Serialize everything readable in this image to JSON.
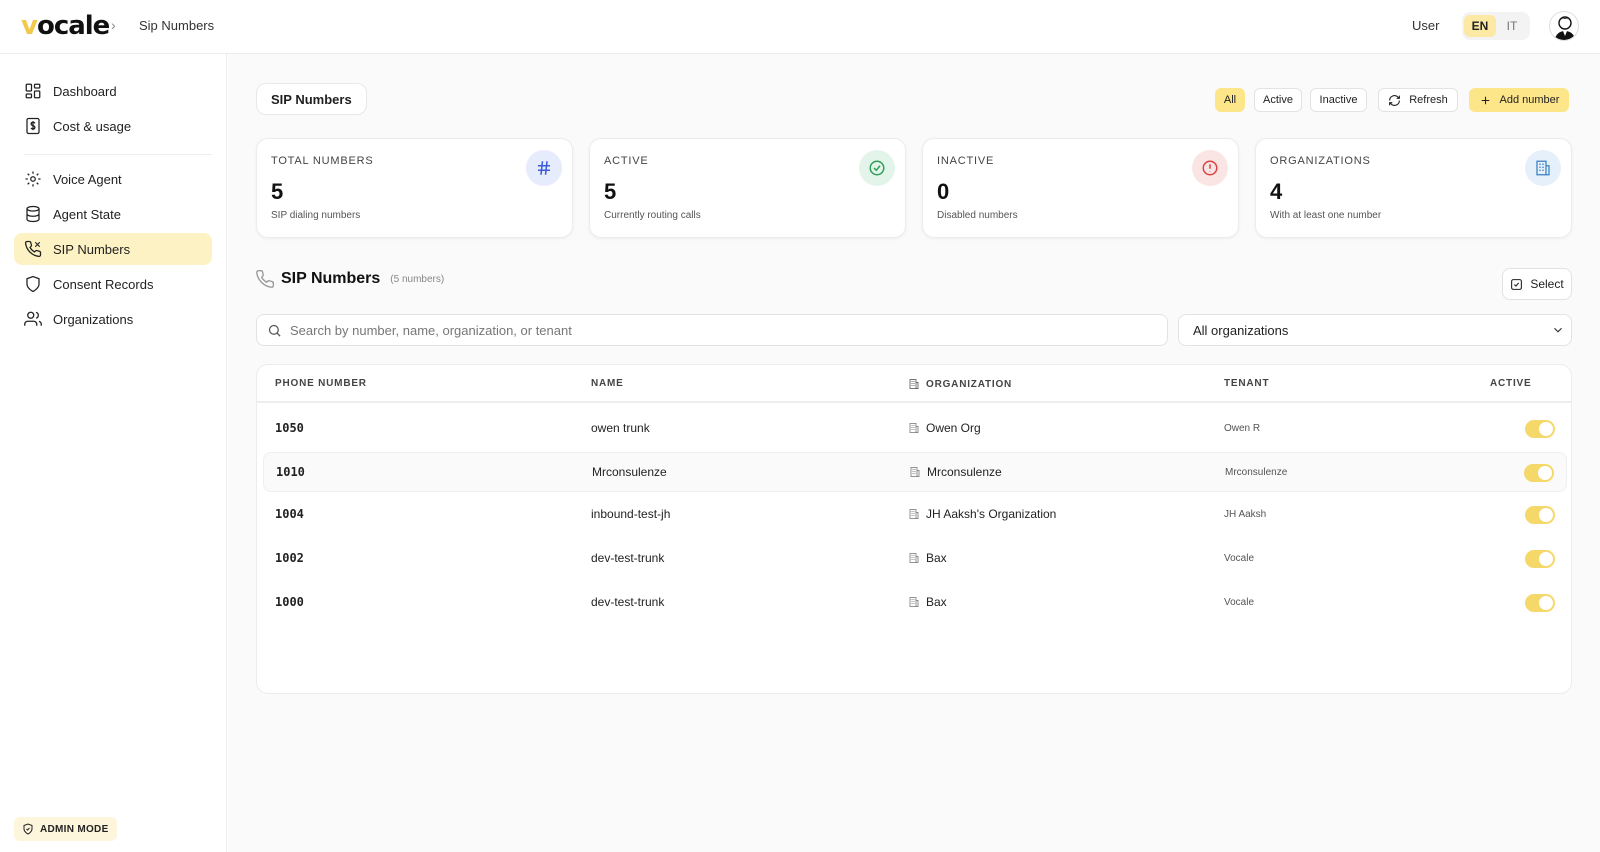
{
  "header": {
    "logo": "vocale",
    "breadcrumb": "Sip Numbers",
    "user_label": "User",
    "languages": [
      "EN",
      "IT"
    ],
    "active_language": "EN"
  },
  "sidebar": {
    "items": [
      {
        "label": "Dashboard",
        "icon": "dashboard-icon"
      },
      {
        "label": "Cost & usage",
        "icon": "dollar-icon"
      },
      {
        "label": "Voice Agent",
        "icon": "gear-icon"
      },
      {
        "label": "Agent State",
        "icon": "database-icon"
      },
      {
        "label": "SIP Numbers",
        "icon": "phone-icon",
        "active": true
      },
      {
        "label": "Consent Records",
        "icon": "shield-icon"
      },
      {
        "label": "Organizations",
        "icon": "users-icon"
      }
    ],
    "admin_mode": "ADMIN MODE"
  },
  "main": {
    "page_title": "SIP Numbers",
    "filters": {
      "all": "All",
      "active": "Active",
      "inactive": "Inactive"
    },
    "refresh_label": "Refresh",
    "add_label": "Add number",
    "cards": [
      {
        "label": "TOTAL NUMBERS",
        "value": "5",
        "sub": "SIP dialing numbers",
        "icon": "hash-icon"
      },
      {
        "label": "ACTIVE",
        "value": "5",
        "sub": "Currently routing calls",
        "icon": "check-circle-icon"
      },
      {
        "label": "INACTIVE",
        "value": "0",
        "sub": "Disabled numbers",
        "icon": "alert-circle-icon"
      },
      {
        "label": "ORGANIZATIONS",
        "value": "4",
        "sub": "With at least one number",
        "icon": "building-icon"
      }
    ],
    "section_title": "SIP Numbers",
    "section_count": "(5 numbers)",
    "select_label": "Select",
    "search_placeholder": "Search by number, name, organization, or tenant",
    "org_filter": "All organizations",
    "table": {
      "columns": [
        "PHONE NUMBER",
        "NAME",
        "ORGANIZATION",
        "TENANT",
        "ACTIVE"
      ],
      "rows": [
        {
          "number": "1050",
          "name": "owen trunk",
          "org": "Owen Org",
          "tenant": "Owen R",
          "active": true
        },
        {
          "number": "1010",
          "name": "Mrconsulenze",
          "org": "Mrconsulenze",
          "tenant": "Mrconsulenze",
          "active": true
        },
        {
          "number": "1004",
          "name": "inbound-test-jh",
          "org": "JH Aaksh's Organization",
          "tenant": "JH Aaksh",
          "active": true
        },
        {
          "number": "1002",
          "name": "dev-test-trunk",
          "org": "Bax",
          "tenant": "Vocale",
          "active": true
        },
        {
          "number": "1000",
          "name": "dev-test-trunk",
          "org": "Bax",
          "tenant": "Vocale",
          "active": true
        }
      ]
    }
  },
  "colors": {
    "accent": "#fde68a",
    "active_nav": "#fdf2c4",
    "toggle_on": "#f5d86a"
  }
}
